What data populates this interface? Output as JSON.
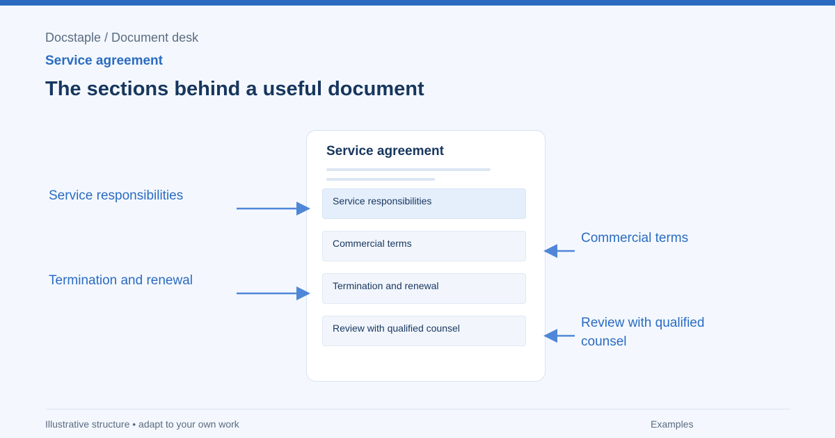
{
  "header": {
    "breadcrumb": "Docstaple / Document desk",
    "eyebrow": "Service agreement",
    "headline": "The sections behind a useful document"
  },
  "document": {
    "title": "Service agreement",
    "sections": [
      {
        "label": "Service responsibilities"
      },
      {
        "label": "Commercial terms"
      },
      {
        "label": "Termination and renewal"
      },
      {
        "label": "Review with qualified counsel"
      }
    ]
  },
  "callouts": {
    "left": [
      {
        "label": "Service responsibilities"
      },
      {
        "label": "Termination and renewal"
      }
    ],
    "right": [
      {
        "label": "Commercial terms"
      },
      {
        "label": "Review with qualified counsel"
      }
    ]
  },
  "footer": {
    "note": "Illustrative structure • adapt to your own work",
    "link": "Examples"
  },
  "colors": {
    "accent": "#2a6bc1",
    "arrow": "#4f86d8",
    "heading": "#17365e",
    "background": "#f4f8fe"
  }
}
